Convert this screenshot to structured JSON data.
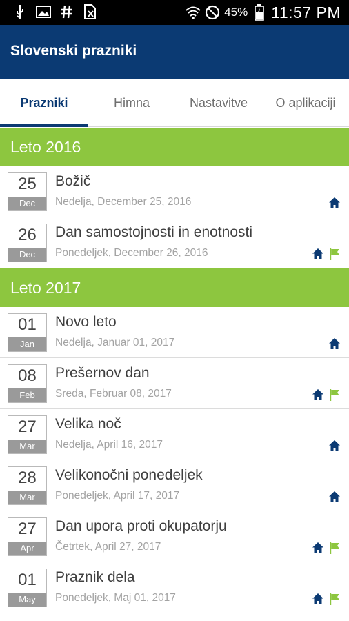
{
  "status_bar": {
    "left_icons": [
      "usb-icon",
      "image-icon",
      "hash-icon",
      "no-sim-icon"
    ],
    "right_icons": [
      "wifi-icon",
      "do-not-disturb-icon",
      "battery-icon"
    ],
    "battery_percent": "45%",
    "time": "11:57 PM"
  },
  "app_bar": {
    "title": "Slovenski prazniki",
    "color": "#0b3a73"
  },
  "tabs": [
    {
      "label": "Prazniki",
      "active": true
    },
    {
      "label": "Himna",
      "active": false
    },
    {
      "label": "Nastavitve",
      "active": false
    },
    {
      "label": "O aplikaciji",
      "active": false
    }
  ],
  "colors": {
    "year_header": "#8dc63f",
    "home_icon": "#0b3a73",
    "flag_icon": "#8dc63f"
  },
  "sections": [
    {
      "year_label": "Leto 2016",
      "holidays": [
        {
          "day": "25",
          "month": "Dec",
          "title": "Božič",
          "date": "Nedelja, December 25, 2016",
          "icons": [
            "home-icon"
          ]
        },
        {
          "day": "26",
          "month": "Dec",
          "title": "Dan samostojnosti in enotnosti",
          "date": "Ponedeljek, December 26, 2016",
          "icons": [
            "home-icon",
            "flag-icon"
          ]
        }
      ]
    },
    {
      "year_label": "Leto 2017",
      "holidays": [
        {
          "day": "01",
          "month": "Jan",
          "title": "Novo leto",
          "date": "Nedelja, Januar 01, 2017",
          "icons": [
            "home-icon"
          ]
        },
        {
          "day": "08",
          "month": "Feb",
          "title": "Prešernov dan",
          "date": "Sreda, Februar 08, 2017",
          "icons": [
            "home-icon",
            "flag-icon"
          ]
        },
        {
          "day": "27",
          "month": "Mar",
          "title": "Velika noč",
          "date": "Nedelja, April 16, 2017",
          "icons": [
            "home-icon"
          ]
        },
        {
          "day": "28",
          "month": "Mar",
          "title": "Velikonočni ponedeljek",
          "date": "Ponedeljek, April 17, 2017",
          "icons": [
            "home-icon"
          ]
        },
        {
          "day": "27",
          "month": "Apr",
          "title": "Dan upora proti okupatorju",
          "date": "Četrtek, April 27, 2017",
          "icons": [
            "home-icon",
            "flag-icon"
          ]
        },
        {
          "day": "01",
          "month": "May",
          "title": "Praznik dela",
          "date": "Ponedeljek, Maj 01, 2017",
          "icons": [
            "home-icon",
            "flag-icon"
          ]
        }
      ]
    }
  ]
}
